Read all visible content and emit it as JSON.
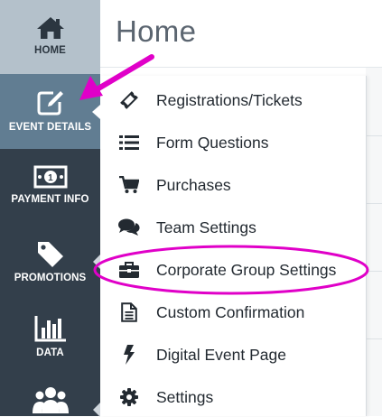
{
  "header": {
    "title": "Home"
  },
  "sidebar": {
    "items": [
      {
        "label": "HOME",
        "icon": "home-icon"
      },
      {
        "label": "EVENT DETAILS",
        "icon": "edit-icon"
      },
      {
        "label": "PAYMENT INFO",
        "icon": "money-icon"
      },
      {
        "label": "PROMOTIONS",
        "icon": "tag-icon"
      },
      {
        "label": "DATA",
        "icon": "bar-chart-icon"
      },
      {
        "label": "",
        "icon": "users-icon"
      }
    ]
  },
  "menu": {
    "items": [
      {
        "label": "Registrations/Tickets",
        "icon": "ticket-icon"
      },
      {
        "label": "Form Questions",
        "icon": "list-icon"
      },
      {
        "label": "Purchases",
        "icon": "cart-icon"
      },
      {
        "label": "Team Settings",
        "icon": "comments-icon"
      },
      {
        "label": "Corporate Group Settings",
        "icon": "briefcase-icon"
      },
      {
        "label": "Custom Confirmation",
        "icon": "document-icon"
      },
      {
        "label": "Digital Event Page",
        "icon": "bolt-icon"
      },
      {
        "label": "Settings",
        "icon": "gear-icon"
      }
    ]
  },
  "colors": {
    "sidebar": "#333f4b",
    "home_active": "#b4c1cb",
    "event_active": "#617d92",
    "annotation": "#e000c8"
  }
}
